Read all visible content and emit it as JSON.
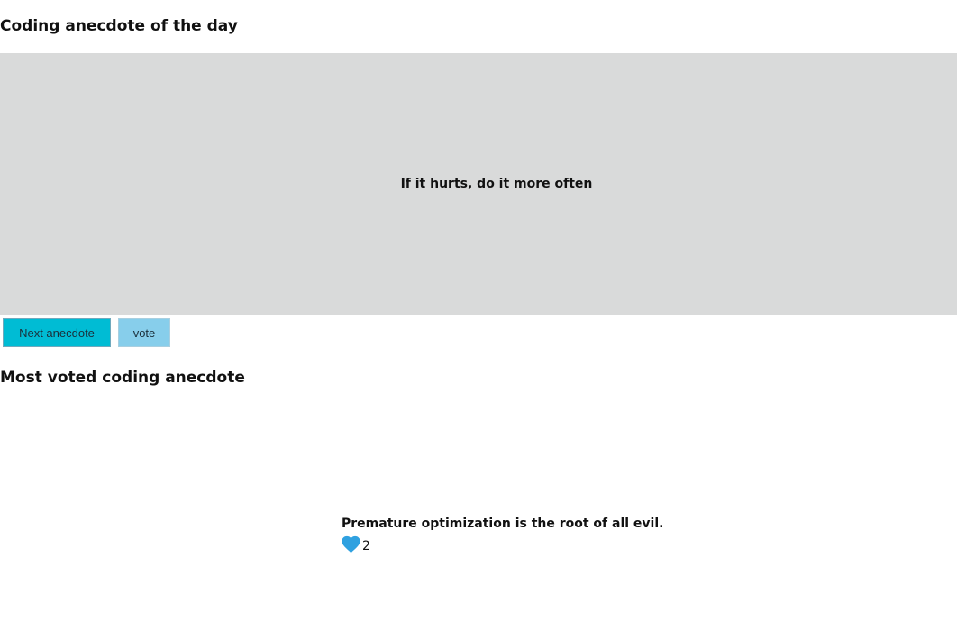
{
  "page": {
    "heading_day": "Coding anecdote of the day",
    "current_anecdote": "If it hurts, do it more often",
    "buttons": {
      "next_label": "Next anecdote",
      "vote_label": "vote"
    },
    "heading_most_voted": "Most voted coding anecdote",
    "most_voted": {
      "text": "Premature optimization is the root of all evil.",
      "votes": "2",
      "icon": "heart-icon"
    }
  },
  "colors": {
    "anecdote_bg": "#d9dada",
    "next_button": "#00bcd4",
    "vote_button": "#87ceeb",
    "heart": "#2fa1e0"
  }
}
